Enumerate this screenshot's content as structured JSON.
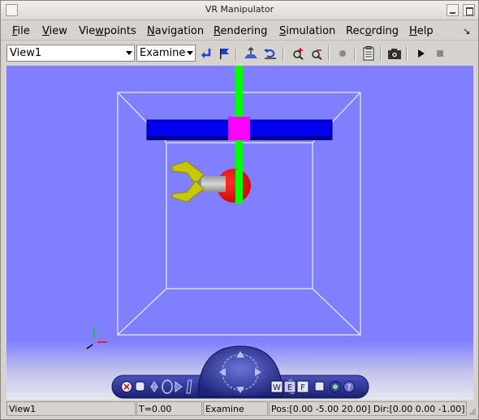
{
  "window": {
    "title": "VR Manipulator"
  },
  "menu": {
    "file": {
      "u": "F",
      "rest": "ile"
    },
    "view": {
      "u": "V",
      "rest": "iew"
    },
    "viewpoints": {
      "pre": "Vie",
      "u": "w",
      "rest": "points"
    },
    "navigation": {
      "u": "N",
      "rest": "avigation"
    },
    "rendering": {
      "u": "R",
      "rest": "endering"
    },
    "simulation": {
      "u": "S",
      "rest": "imulation"
    },
    "recording": {
      "pre": "Rec",
      "u": "o",
      "rest": "rding"
    },
    "help": {
      "u": "H",
      "rest": "elp"
    }
  },
  "toolbar": {
    "viewpoint_select": "View1",
    "navigation_select": "Examine",
    "icons": [
      "go-to-viewpoint-icon",
      "set-viewpoint-flag-icon",
      "straighten-up-icon",
      "restore-view-icon",
      "zoom-in-icon",
      "zoom-out-icon",
      "record-icon",
      "scene-list-icon",
      "snapshot-camera-icon",
      "play-icon",
      "stop-icon"
    ]
  },
  "navpanel": {
    "mode_buttons": [
      "W",
      "E",
      "F"
    ],
    "help_glyph": "?"
  },
  "status": {
    "viewpoint": "View1",
    "time": "T=0.00",
    "mode": "Examine",
    "position": "Pos:[0.00 -5.00 20.00] Dir:[0.00 0.00 -1.00]"
  },
  "colors": {
    "viewport_bg": "#8080ff",
    "rail": "#0000ff",
    "carriage": "#ff00ff",
    "column": "#00ff00",
    "gripper": "#cccc00",
    "joint": "#ff0000"
  }
}
